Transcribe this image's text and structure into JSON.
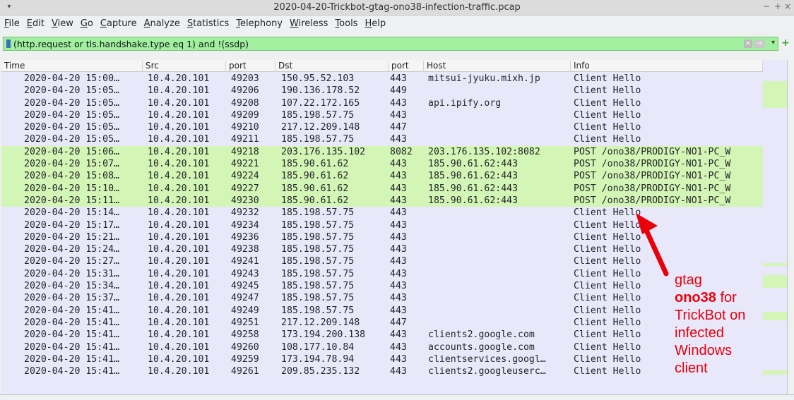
{
  "window": {
    "title": "2020-04-20-Trickbot-gtag-ono38-infection-traffic.pcap",
    "controls": [
      "−",
      "+",
      "×"
    ]
  },
  "menu": [
    "File",
    "Edit",
    "View",
    "Go",
    "Capture",
    "Analyze",
    "Statistics",
    "Telephony",
    "Wireless",
    "Tools",
    "Help"
  ],
  "filter": {
    "value": "(http.request or tls.handshake.type eq 1) and !(ssdp)"
  },
  "columns": [
    "Time",
    "Src",
    "port",
    "Dst",
    "port",
    "Host",
    "Info"
  ],
  "rows": [
    {
      "time": "2020-04-20 15:00…",
      "src": "10.4.20.101",
      "sport": "49203",
      "dst": "150.95.52.103",
      "dport": "443",
      "host": "mitsui-jyuku.mixh.jp",
      "info": "Client Hello",
      "hl": false
    },
    {
      "time": "2020-04-20 15:05…",
      "src": "10.4.20.101",
      "sport": "49206",
      "dst": "190.136.178.52",
      "dport": "449",
      "host": "",
      "info": "Client Hello",
      "hl": false
    },
    {
      "time": "2020-04-20 15:05…",
      "src": "10.4.20.101",
      "sport": "49208",
      "dst": "107.22.172.165",
      "dport": "443",
      "host": "api.ipify.org",
      "info": "Client Hello",
      "hl": false
    },
    {
      "time": "2020-04-20 15:05…",
      "src": "10.4.20.101",
      "sport": "49209",
      "dst": "185.198.57.75",
      "dport": "443",
      "host": "",
      "info": "Client Hello",
      "hl": false
    },
    {
      "time": "2020-04-20 15:05…",
      "src": "10.4.20.101",
      "sport": "49210",
      "dst": "217.12.209.148",
      "dport": "447",
      "host": "",
      "info": "Client Hello",
      "hl": false
    },
    {
      "time": "2020-04-20 15:05…",
      "src": "10.4.20.101",
      "sport": "49211",
      "dst": "185.198.57.75",
      "dport": "443",
      "host": "",
      "info": "Client Hello",
      "hl": false
    },
    {
      "time": "2020-04-20 15:06…",
      "src": "10.4.20.101",
      "sport": "49218",
      "dst": "203.176.135.102",
      "dport": "8082",
      "host": "203.176.135.102:8082",
      "info": "POST /ono38/PRODIGY-NO1-PC_W",
      "hl": true
    },
    {
      "time": "2020-04-20 15:07…",
      "src": "10.4.20.101",
      "sport": "49221",
      "dst": "185.90.61.62",
      "dport": "443",
      "host": "185.90.61.62:443",
      "info": "POST /ono38/PRODIGY-NO1-PC_W",
      "hl": true
    },
    {
      "time": "2020-04-20 15:08…",
      "src": "10.4.20.101",
      "sport": "49224",
      "dst": "185.90.61.62",
      "dport": "443",
      "host": "185.90.61.62:443",
      "info": "POST /ono38/PRODIGY-NO1-PC_W",
      "hl": true
    },
    {
      "time": "2020-04-20 15:10…",
      "src": "10.4.20.101",
      "sport": "49227",
      "dst": "185.90.61.62",
      "dport": "443",
      "host": "185.90.61.62:443",
      "info": "POST /ono38/PRODIGY-NO1-PC_W",
      "hl": true
    },
    {
      "time": "2020-04-20 15:11…",
      "src": "10.4.20.101",
      "sport": "49230",
      "dst": "185.90.61.62",
      "dport": "443",
      "host": "185.90.61.62:443",
      "info": "POST /ono38/PRODIGY-NO1-PC_W",
      "hl": true
    },
    {
      "time": "2020-04-20 15:14…",
      "src": "10.4.20.101",
      "sport": "49232",
      "dst": "185.198.57.75",
      "dport": "443",
      "host": "",
      "info": "Client Hello",
      "hl": false
    },
    {
      "time": "2020-04-20 15:17…",
      "src": "10.4.20.101",
      "sport": "49234",
      "dst": "185.198.57.75",
      "dport": "443",
      "host": "",
      "info": "Client Hello",
      "hl": false
    },
    {
      "time": "2020-04-20 15:21…",
      "src": "10.4.20.101",
      "sport": "49236",
      "dst": "185.198.57.75",
      "dport": "443",
      "host": "",
      "info": "Client Hello",
      "hl": false
    },
    {
      "time": "2020-04-20 15:24…",
      "src": "10.4.20.101",
      "sport": "49238",
      "dst": "185.198.57.75",
      "dport": "443",
      "host": "",
      "info": "Client Hello",
      "hl": false
    },
    {
      "time": "2020-04-20 15:27…",
      "src": "10.4.20.101",
      "sport": "49241",
      "dst": "185.198.57.75",
      "dport": "443",
      "host": "",
      "info": "Client Hello",
      "hl": false
    },
    {
      "time": "2020-04-20 15:31…",
      "src": "10.4.20.101",
      "sport": "49243",
      "dst": "185.198.57.75",
      "dport": "443",
      "host": "",
      "info": "Client Hello",
      "hl": false
    },
    {
      "time": "2020-04-20 15:34…",
      "src": "10.4.20.101",
      "sport": "49245",
      "dst": "185.198.57.75",
      "dport": "443",
      "host": "",
      "info": "Client Hello",
      "hl": false
    },
    {
      "time": "2020-04-20 15:37…",
      "src": "10.4.20.101",
      "sport": "49247",
      "dst": "185.198.57.75",
      "dport": "443",
      "host": "",
      "info": "Client Hello",
      "hl": false
    },
    {
      "time": "2020-04-20 15:41…",
      "src": "10.4.20.101",
      "sport": "49249",
      "dst": "185.198.57.75",
      "dport": "443",
      "host": "",
      "info": "Client Hello",
      "hl": false
    },
    {
      "time": "2020-04-20 15:41…",
      "src": "10.4.20.101",
      "sport": "49251",
      "dst": "217.12.209.148",
      "dport": "447",
      "host": "",
      "info": "Client Hello",
      "hl": false
    },
    {
      "time": "2020-04-20 15:41…",
      "src": "10.4.20.101",
      "sport": "49258",
      "dst": "173.194.200.138",
      "dport": "443",
      "host": "clients2.google.com",
      "info": "Client Hello",
      "hl": false
    },
    {
      "time": "2020-04-20 15:41…",
      "src": "10.4.20.101",
      "sport": "49260",
      "dst": "108.177.10.84",
      "dport": "443",
      "host": "accounts.google.com",
      "info": "Client Hello",
      "hl": false
    },
    {
      "time": "2020-04-20 15:41…",
      "src": "10.4.20.101",
      "sport": "49259",
      "dst": "173.194.78.94",
      "dport": "443",
      "host": "clientservices.googl…",
      "info": "Client Hello",
      "hl": false
    },
    {
      "time": "2020-04-20 15:41…",
      "src": "10.4.20.101",
      "sport": "49261",
      "dst": "209.85.235.132",
      "dport": "443",
      "host": "clients2.googleuserc…",
      "info": "Client Hello",
      "hl": false
    }
  ],
  "annotation": {
    "line1": "gtag",
    "bold": "ono38",
    "line2_rest": " for",
    "line3": "TrickBot on",
    "line4": "infected",
    "line5": "Windows",
    "line6": "client"
  },
  "colors": {
    "row_default": "#e8e8fa",
    "row_http": "#d3f5b5",
    "filter_valid": "#a0f0a0",
    "annotation": "#e8000b"
  }
}
